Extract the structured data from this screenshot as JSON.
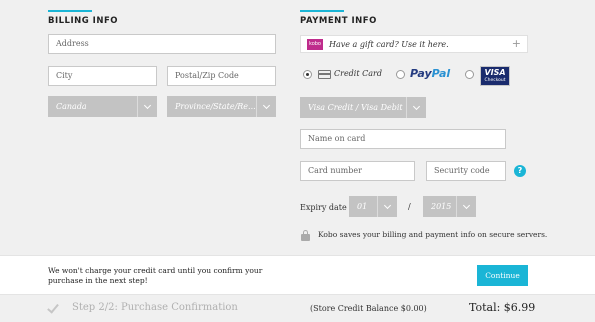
{
  "billing": {
    "heading": "BILLING INFO",
    "address_placeholder": "Address",
    "city_placeholder": "City",
    "postal_placeholder": "Postal/Zip Code",
    "country_value": "Canada",
    "province_value": "Province/State/Re..."
  },
  "payment": {
    "heading": "PAYMENT INFO",
    "gift_card_logo": "kobo",
    "gift_card_text": "Have a gift card? Use it here.",
    "gift_card_plus": "+",
    "methods": {
      "credit_card_label": "Credit Card",
      "paypal_part1": "Pay",
      "paypal_part2": "Pal",
      "visa_label": "VISA",
      "visa_sub": "Checkout",
      "selected": "credit_card"
    },
    "card_type_value": "Visa Credit / Visa Debit",
    "name_placeholder": "Name on card",
    "card_number_placeholder": "Card number",
    "security_placeholder": "Security code",
    "help_symbol": "?",
    "expiry_label": "Expiry date",
    "expiry_month": "01",
    "expiry_separator": "/",
    "expiry_year": "2015",
    "secure_text": "Kobo saves your billing and payment info on secure servers."
  },
  "notice": {
    "text": "We won't charge your credit card until you confirm your purchase in the next step!",
    "continue_label": "Continue"
  },
  "footer": {
    "step_label": "Step 2/2: Purchase Confirmation",
    "store_credit": "(Store Credit Balance $0.00)",
    "total": "Total: $6.99"
  },
  "colors": {
    "accent": "#1ab5d6",
    "kobo": "#bf2c8c",
    "paypal_dark": "#243b80",
    "paypal_light": "#2a91d2",
    "visa": "#1a2b6d"
  }
}
